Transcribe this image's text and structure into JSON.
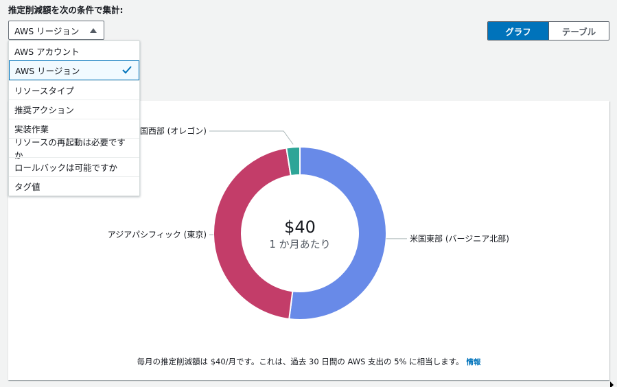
{
  "heading": "推定削減額を次の条件で集計:",
  "select": {
    "value": "AWS リージョン"
  },
  "dropdown": {
    "options": [
      "AWS アカウント",
      "AWS リージョン",
      "リソースタイプ",
      "推奨アクション",
      "実装作業",
      "リソースの再起動は必要ですか",
      "ロールバックは可能ですか",
      "タグ値"
    ],
    "selected_index": 1
  },
  "view_toggle": {
    "graph": "グラフ",
    "table": "テーブル",
    "active": "graph"
  },
  "colors": {
    "accent": "#0073bb",
    "slice_blue": "#688ae8",
    "slice_pink": "#c33d69",
    "slice_teal": "#2ea597"
  },
  "chart_data": {
    "type": "pie",
    "style": "donut",
    "center_value": "$40",
    "center_label": "1 か月あたり",
    "slices": [
      {
        "label": "米国東部 (バージニア北部)",
        "value": 52,
        "color": "#688ae8"
      },
      {
        "label": "アジアパシフィック (東京)",
        "value": 45.5,
        "color": "#c33d69"
      },
      {
        "label": "米国西部 (オレゴン)",
        "value": 2.5,
        "color": "#2ea597"
      }
    ]
  },
  "footer": {
    "text": "毎月の推定削減額は $40/月です。これは、過去 30 日間の AWS 支出の 5% に相当します。",
    "info_link": "情報"
  }
}
